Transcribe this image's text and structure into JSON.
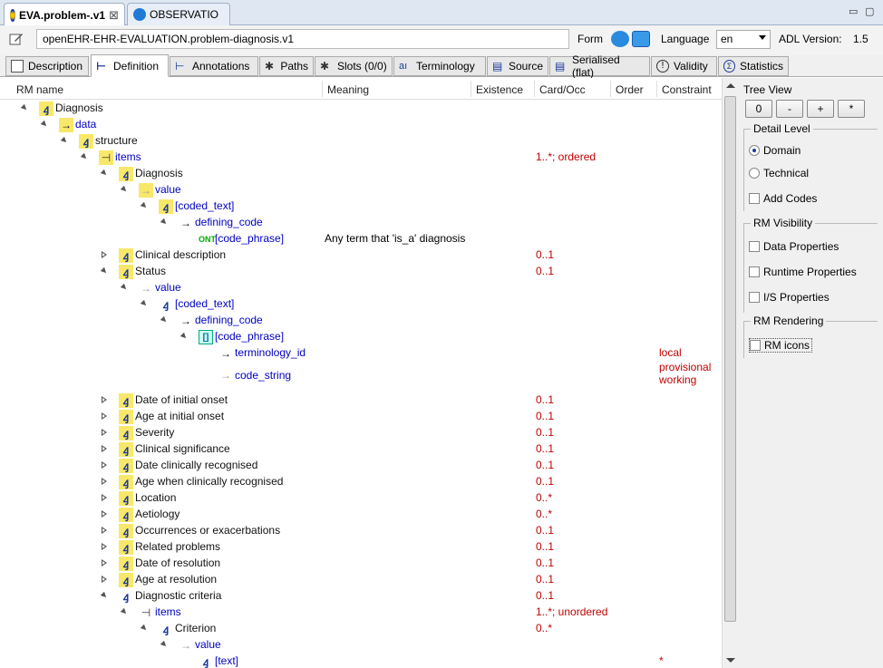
{
  "editor_tabs": [
    {
      "label": "EVA.problem-.v1",
      "active": true,
      "icon": "archetype-icon"
    },
    {
      "label": "OBSERVATIO",
      "active": false,
      "icon": "observation-icon"
    }
  ],
  "window_controls": {
    "minimize": "▭",
    "maximize": "▢"
  },
  "header": {
    "archetype_id": "openEHR-EHR-EVALUATION.problem-diagnosis.v1",
    "form_label": "Form",
    "language_label": "Language",
    "language_value": "en",
    "adl_label": "ADL Version:",
    "adl_value": "1.5"
  },
  "section_tabs": [
    {
      "label": "Description",
      "icon": "description-icon"
    },
    {
      "label": "Definition",
      "icon": "definition-icon",
      "active": true
    },
    {
      "label": "Annotations",
      "icon": "annotations-icon"
    },
    {
      "label": "Paths",
      "icon": "paths-icon"
    },
    {
      "label": "Slots (0/0)",
      "icon": "slots-icon"
    },
    {
      "label": "Terminology",
      "icon": "terminology-icon"
    },
    {
      "label": "Source",
      "icon": "source-icon"
    },
    {
      "label": "Serialised (flat)",
      "icon": "serialised-icon"
    },
    {
      "label": "Validity",
      "icon": "validity-icon"
    },
    {
      "label": "Statistics",
      "icon": "statistics-icon"
    }
  ],
  "columns": {
    "rm_name": "RM name",
    "meaning": "Meaning",
    "existence": "Existence",
    "card_occ": "Card/Occ",
    "order": "Order",
    "constraint": "Constraint"
  },
  "rows": [
    {
      "label": "Diagnosis",
      "meaning": "",
      "card": "",
      "constraint": ""
    },
    {
      "label": "data",
      "meaning": "",
      "card": "",
      "constraint": ""
    },
    {
      "label": "structure",
      "meaning": "",
      "card": "",
      "constraint": ""
    },
    {
      "label": "items",
      "meaning": "",
      "card": "1..*; ordered",
      "constraint": ""
    },
    {
      "label": "Diagnosis",
      "meaning": "",
      "card": "",
      "constraint": ""
    },
    {
      "label": "value",
      "meaning": "",
      "card": "",
      "constraint": ""
    },
    {
      "label": "[coded_text]",
      "meaning": "",
      "card": "",
      "constraint": ""
    },
    {
      "label": "defining_code",
      "meaning": "",
      "card": "",
      "constraint": ""
    },
    {
      "label": "[code_phrase]",
      "meaning": "Any term that 'is_a' diagnosis",
      "card": "",
      "constraint": ""
    },
    {
      "label": "Clinical description",
      "meaning": "",
      "card": "0..1",
      "constraint": ""
    },
    {
      "label": "Status",
      "meaning": "",
      "card": "0..1",
      "constraint": ""
    },
    {
      "label": "value",
      "meaning": "",
      "card": "",
      "constraint": ""
    },
    {
      "label": "[coded_text]",
      "meaning": "",
      "card": "",
      "constraint": ""
    },
    {
      "label": "defining_code",
      "meaning": "",
      "card": "",
      "constraint": ""
    },
    {
      "label": "[code_phrase]",
      "meaning": "",
      "card": "",
      "constraint": ""
    },
    {
      "label": "terminology_id",
      "meaning": "",
      "card": "",
      "constraint": "local"
    },
    {
      "label": "code_string",
      "meaning": "",
      "card": "",
      "constraint": "provisional",
      "constraint2": "working"
    },
    {
      "label": "Date of initial onset",
      "meaning": "",
      "card": "0..1",
      "constraint": ""
    },
    {
      "label": "Age at initial onset",
      "meaning": "",
      "card": "0..1",
      "constraint": ""
    },
    {
      "label": "Severity",
      "meaning": "",
      "card": "0..1",
      "constraint": ""
    },
    {
      "label": "Clinical significance",
      "meaning": "",
      "card": "0..1",
      "constraint": ""
    },
    {
      "label": "Date clinically recognised",
      "meaning": "",
      "card": "0..1",
      "constraint": ""
    },
    {
      "label": "Age when clinically recognised",
      "meaning": "",
      "card": "0..1",
      "constraint": ""
    },
    {
      "label": "Location",
      "meaning": "",
      "card": "0..*",
      "constraint": ""
    },
    {
      "label": "Aetiology",
      "meaning": "",
      "card": "0..*",
      "constraint": ""
    },
    {
      "label": "Occurrences or exacerbations",
      "meaning": "",
      "card": "0..1",
      "constraint": ""
    },
    {
      "label": "Related problems",
      "meaning": "",
      "card": "0..1",
      "constraint": ""
    },
    {
      "label": "Date of resolution",
      "meaning": "",
      "card": "0..1",
      "constraint": ""
    },
    {
      "label": "Age at resolution",
      "meaning": "",
      "card": "0..1",
      "constraint": ""
    },
    {
      "label": "Diagnostic criteria",
      "meaning": "",
      "card": "0..1",
      "constraint": ""
    },
    {
      "label": "items",
      "meaning": "",
      "card": "1..*; unordered",
      "constraint": ""
    },
    {
      "label": "Criterion",
      "meaning": "",
      "card": "0..*",
      "constraint": ""
    },
    {
      "label": "value",
      "meaning": "",
      "card": "",
      "constraint": ""
    },
    {
      "label": "[text]",
      "meaning": "",
      "card": "",
      "constraint": "*"
    }
  ],
  "right_panel": {
    "tree_view_label": "Tree View",
    "tree_buttons": [
      "0",
      "-",
      "+",
      "*"
    ],
    "detail_level": {
      "title": "Detail Level",
      "domain": "Domain",
      "technical": "Technical",
      "add_codes": "Add Codes"
    },
    "rm_visibility": {
      "title": "RM Visibility",
      "data": "Data Properties",
      "runtime": "Runtime Properties",
      "is": "I/S Properties"
    },
    "rm_rendering": {
      "title": "RM Rendering",
      "icons": "RM icons"
    }
  },
  "colors": {
    "accent_blue": "#0000c0",
    "card_red": "#c00000",
    "icon_yellow": "#f8e86a"
  }
}
